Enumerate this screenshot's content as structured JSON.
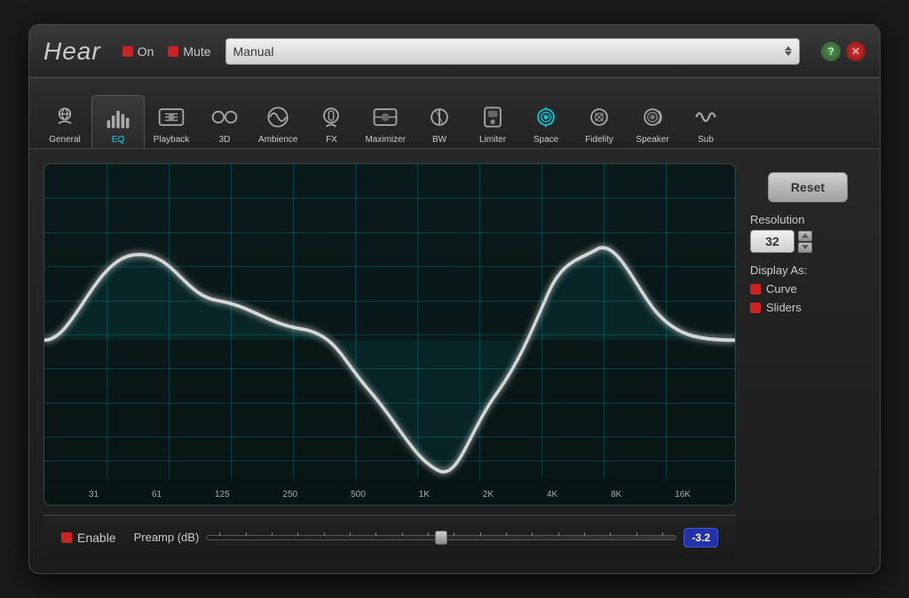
{
  "app": {
    "title": "Hear",
    "on_label": "On",
    "mute_label": "Mute",
    "preset": "Manual",
    "help_icon": "?",
    "close_icon": "✕"
  },
  "tabs": [
    {
      "id": "general",
      "label": "General",
      "active": false
    },
    {
      "id": "eq",
      "label": "EQ",
      "active": true
    },
    {
      "id": "playback",
      "label": "Playback",
      "active": false
    },
    {
      "id": "3d",
      "label": "3D",
      "active": false
    },
    {
      "id": "ambience",
      "label": "Ambience",
      "active": false
    },
    {
      "id": "fx",
      "label": "FX",
      "active": false
    },
    {
      "id": "maximizer",
      "label": "Maximizer",
      "active": false
    },
    {
      "id": "bw",
      "label": "BW",
      "active": false
    },
    {
      "id": "limiter",
      "label": "Limiter",
      "active": false
    },
    {
      "id": "space",
      "label": "Space",
      "active": false
    },
    {
      "id": "fidelity",
      "label": "Fidelity",
      "active": false
    },
    {
      "id": "speaker",
      "label": "Speaker",
      "active": false
    },
    {
      "id": "sub",
      "label": "Sub",
      "active": false
    }
  ],
  "eq": {
    "freq_labels": [
      "31",
      "61",
      "125",
      "250",
      "500",
      "1K",
      "2K",
      "4K",
      "8K",
      "16K"
    ],
    "reset_label": "Reset",
    "resolution_label": "Resolution",
    "resolution_value": "32",
    "display_as_label": "Display As:",
    "display_options": [
      "Curve",
      "Sliders"
    ],
    "enable_label": "Enable",
    "preamp_label": "Preamp (dB)",
    "preamp_value": "-3.2"
  }
}
